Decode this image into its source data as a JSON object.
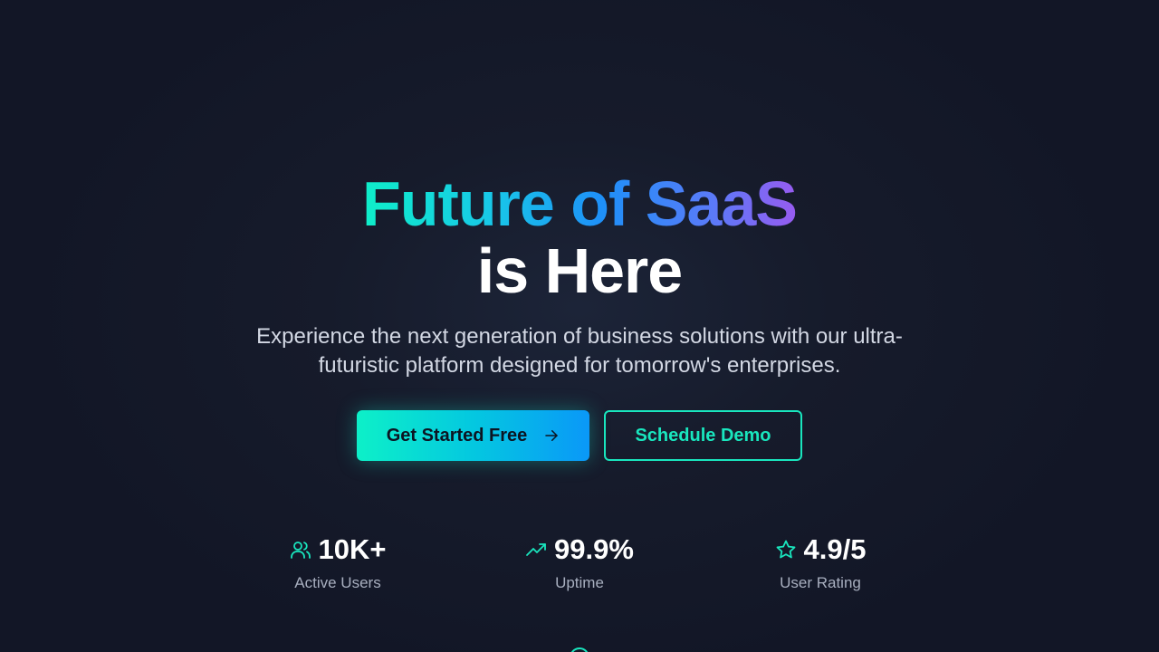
{
  "hero": {
    "headline_line1": "Future of SaaS",
    "headline_line2": "is Here",
    "subtitle": "Experience the next generation of business solutions with our ultra-futuristic platform designed for tomorrow's enterprises."
  },
  "buttons": {
    "primary_label": "Get Started Free",
    "primary_icon": "arrow-right-icon",
    "secondary_label": "Schedule Demo"
  },
  "stats": [
    {
      "icon": "users-icon",
      "value": "10K+",
      "label": "Active Users"
    },
    {
      "icon": "trending-up-icon",
      "value": "99.9%",
      "label": "Uptime"
    },
    {
      "icon": "star-icon",
      "value": "4.9/5",
      "label": "User Rating"
    }
  ],
  "colors": {
    "accent": "#19e6be",
    "gradient_start": "#0ef0c8",
    "gradient_mid": "#1e90f8",
    "gradient_end": "#9a5af0",
    "background": "#141929"
  }
}
